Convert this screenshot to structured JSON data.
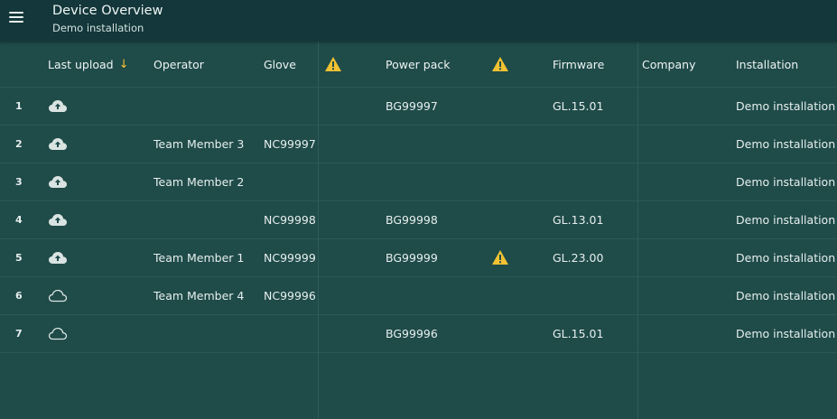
{
  "header": {
    "title": "Device Overview",
    "subtitle": "Demo installation"
  },
  "columns": {
    "last_upload": "Last upload",
    "sort_indicator": "↓",
    "operator": "Operator",
    "glove": "Glove",
    "power_pack": "Power pack",
    "firmware": "Firmware",
    "company": "Company",
    "installation": "Installation"
  },
  "colors": {
    "warning": "#f2c232",
    "background": "#1f4b49",
    "appbar": "#13373a"
  },
  "rows": [
    {
      "num": "1",
      "upload_icon": "cloud-upload-icon",
      "operator": "",
      "glove": "",
      "power_pack": "BG99997",
      "power_pack_warning": false,
      "firmware": "GL.15.01",
      "company": "",
      "installation": "Demo installation"
    },
    {
      "num": "2",
      "upload_icon": "cloud-upload-icon",
      "operator": "Team Member 3",
      "glove": "NC99997",
      "power_pack": "",
      "power_pack_warning": false,
      "firmware": "",
      "company": "",
      "installation": "Demo installation"
    },
    {
      "num": "3",
      "upload_icon": "cloud-upload-icon",
      "operator": "Team Member 2",
      "glove": "",
      "power_pack": "",
      "power_pack_warning": false,
      "firmware": "",
      "company": "",
      "installation": "Demo installation"
    },
    {
      "num": "4",
      "upload_icon": "cloud-upload-icon",
      "operator": "",
      "glove": "NC99998",
      "power_pack": "BG99998",
      "power_pack_warning": false,
      "firmware": "GL.13.01",
      "company": "",
      "installation": "Demo installation"
    },
    {
      "num": "5",
      "upload_icon": "cloud-upload-icon",
      "operator": "Team Member 1",
      "glove": "NC99999",
      "power_pack": "BG99999",
      "power_pack_warning": true,
      "firmware": "GL.23.00",
      "company": "",
      "installation": "Demo installation"
    },
    {
      "num": "6",
      "upload_icon": "cloud-outline-icon",
      "operator": "Team Member 4",
      "glove": "NC99996",
      "power_pack": "",
      "power_pack_warning": false,
      "firmware": "",
      "company": "",
      "installation": "Demo installation"
    },
    {
      "num": "7",
      "upload_icon": "cloud-outline-icon",
      "operator": "",
      "glove": "",
      "power_pack": "BG99996",
      "power_pack_warning": false,
      "firmware": "GL.15.01",
      "company": "",
      "installation": "Demo installation"
    }
  ]
}
